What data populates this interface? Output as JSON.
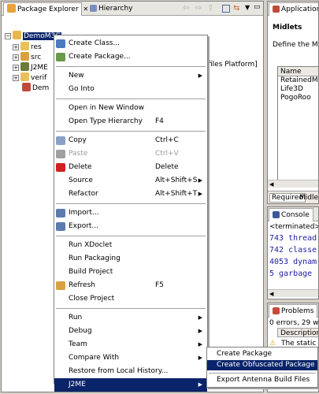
{
  "package_explorer": {
    "tab_label": "Package Explorer",
    "tab_close": "✕",
    "hierarchy_tab": "Hierarchy",
    "tree": [
      {
        "label": "DemoM3G",
        "expanded": true
      },
      {
        "label": "res"
      },
      {
        "label": "src"
      },
      {
        "label": "J2ME"
      },
      {
        "label": "verif"
      },
      {
        "label": "Dem"
      }
    ],
    "files_platform_text": "files Platform]"
  },
  "app_descriptor": {
    "tab_label": "Application D",
    "section_title": "Midlets",
    "description": "Define the Midl",
    "table_header": "Name",
    "rows": [
      "RetainedMo",
      "Life3D",
      "PogoRoo"
    ],
    "bottom_tabs": [
      "Required",
      "Midlet"
    ]
  },
  "console": {
    "tab_label": "Console",
    "status": "<terminated> Pc",
    "lines": [
      "743 thread",
      "742 classe",
      "4053 dynam",
      "5 garbage"
    ]
  },
  "problems": {
    "tab_label": "Problems",
    "summary": "0 errors, 29 warn",
    "column": "Description",
    "row": "The static fi"
  },
  "context_menu": {
    "items": [
      {
        "label": "Create Class...",
        "shortcut": "",
        "submenu": false,
        "disabled": false
      },
      {
        "label": "Create Package...",
        "shortcut": "",
        "submenu": false,
        "disabled": false
      },
      {
        "sep": true
      },
      {
        "label": "New",
        "shortcut": "",
        "submenu": true,
        "disabled": false
      },
      {
        "label": "Go Into",
        "shortcut": "",
        "submenu": false,
        "disabled": false
      },
      {
        "sep": true
      },
      {
        "label": "Open in New Window",
        "shortcut": "",
        "submenu": false,
        "disabled": false
      },
      {
        "label": "Open Type Hierarchy",
        "shortcut": "F4",
        "submenu": false,
        "disabled": false
      },
      {
        "sep": true
      },
      {
        "label": "Copy",
        "shortcut": "Ctrl+C",
        "submenu": false,
        "disabled": false
      },
      {
        "label": "Paste",
        "shortcut": "Ctrl+V",
        "submenu": false,
        "disabled": true
      },
      {
        "label": "Delete",
        "shortcut": "Delete",
        "submenu": false,
        "disabled": false
      },
      {
        "label": "Source",
        "shortcut": "Alt+Shift+S",
        "submenu": true,
        "disabled": false
      },
      {
        "label": "Refactor",
        "shortcut": "Alt+Shift+T",
        "submenu": true,
        "disabled": false
      },
      {
        "sep": true
      },
      {
        "label": "Import...",
        "shortcut": "",
        "submenu": false,
        "disabled": false
      },
      {
        "label": "Export...",
        "shortcut": "",
        "submenu": false,
        "disabled": false
      },
      {
        "sep": true
      },
      {
        "label": "Run XDoclet",
        "shortcut": "",
        "submenu": false,
        "disabled": false
      },
      {
        "label": "Run Packaging",
        "shortcut": "",
        "submenu": false,
        "disabled": false
      },
      {
        "label": "Build Project",
        "shortcut": "",
        "submenu": false,
        "disabled": false
      },
      {
        "label": "Refresh",
        "shortcut": "F5",
        "submenu": false,
        "disabled": false
      },
      {
        "label": "Close Project",
        "shortcut": "",
        "submenu": false,
        "disabled": false
      },
      {
        "sep": true
      },
      {
        "label": "Run",
        "shortcut": "",
        "submenu": true,
        "disabled": false
      },
      {
        "label": "Debug",
        "shortcut": "",
        "submenu": true,
        "disabled": false
      },
      {
        "label": "Team",
        "shortcut": "",
        "submenu": true,
        "disabled": false
      },
      {
        "label": "Compare With",
        "shortcut": "",
        "submenu": true,
        "disabled": false
      },
      {
        "label": "Restore from Local History...",
        "shortcut": "",
        "submenu": false,
        "disabled": false
      },
      {
        "label": "J2ME",
        "shortcut": "",
        "submenu": true,
        "disabled": false,
        "highlight": true
      },
      {
        "sep": true
      },
      {
        "label": "Properties",
        "shortcut": "Alt+Enter",
        "submenu": false,
        "disabled": false
      }
    ]
  },
  "submenu": {
    "items": [
      {
        "label": "Create Package",
        "highlight": false
      },
      {
        "label": "Create Obfuscated Package",
        "highlight": true
      },
      {
        "sep": true
      },
      {
        "label": "Export Antenna Build Files",
        "highlight": false
      }
    ]
  },
  "colors": {
    "highlight": "#0a246a",
    "menu_bg": "#ffffff",
    "chrome": "#d4d0c8"
  },
  "icons": {
    "create_class": "class-icon",
    "create_package": "package-icon",
    "copy": "copy-icon",
    "paste": "paste-icon",
    "delete": "delete-icon",
    "import": "import-icon",
    "export": "export-icon",
    "refresh": "refresh-icon"
  }
}
